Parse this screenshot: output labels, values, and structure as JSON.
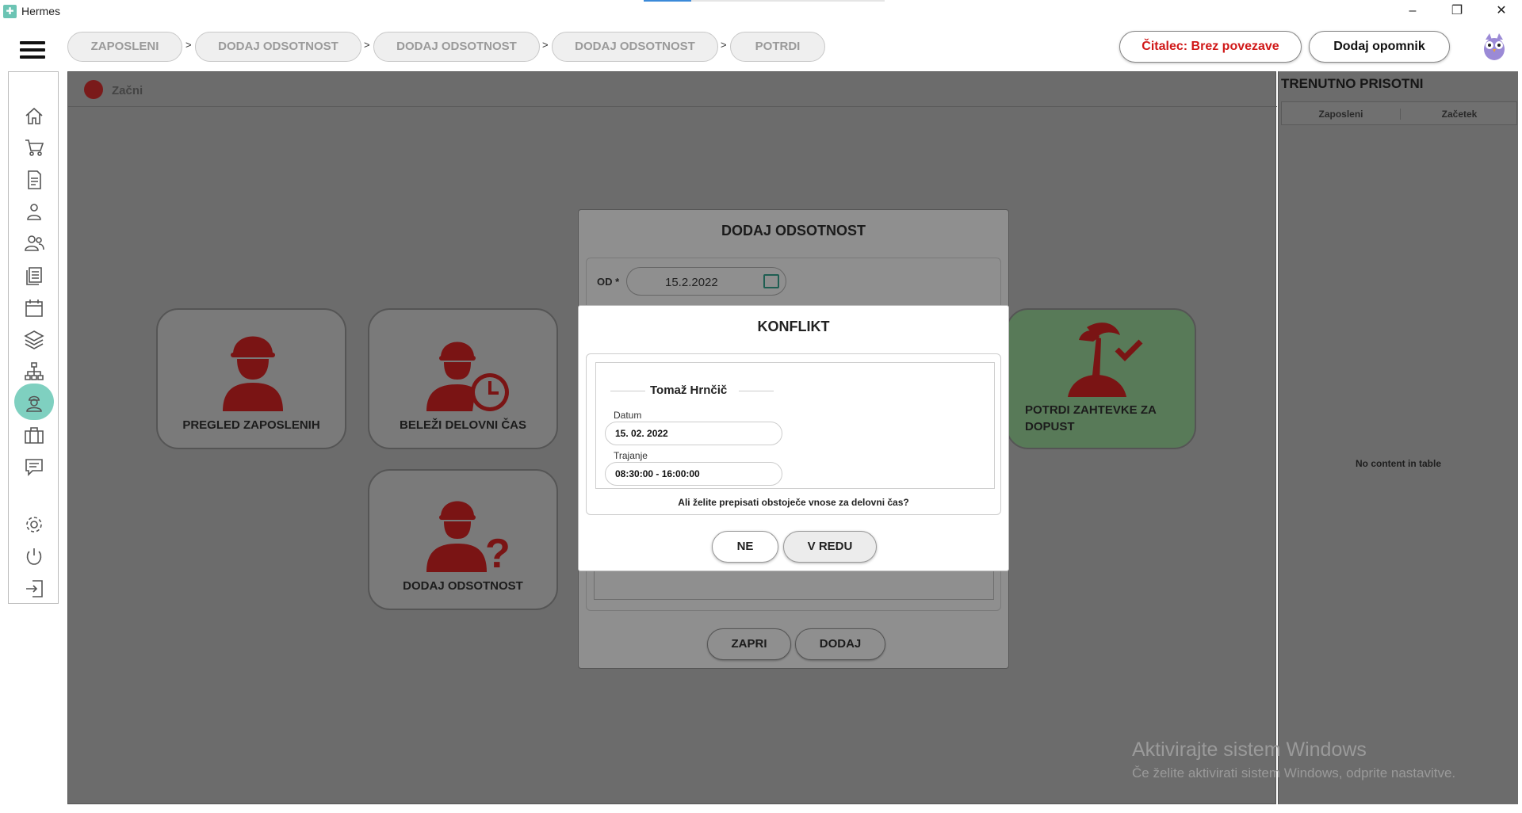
{
  "window": {
    "title": "Hermes",
    "icon": "app-logo-icon",
    "controls": [
      "minimize-icon",
      "restore-icon",
      "close-icon"
    ]
  },
  "breadcrumb": [
    {
      "label": "ZAPOSLENI"
    },
    {
      "label": "DODAJ ODSOTNOST"
    },
    {
      "label": "DODAJ ODSOTNOST"
    },
    {
      "label": "DODAJ ODSOTNOST"
    },
    {
      "label": "POTRDI"
    }
  ],
  "breadcrumb_separator": ">",
  "header": {
    "reader_status": "Čitalec: Brez povezave",
    "reader_status_color": "#d01818",
    "reminder_button": "Dodaj opomnik",
    "menu_icon": "hamburger-icon",
    "avatar_icon": "owl-mascot-icon"
  },
  "sidebar": {
    "items": [
      {
        "icon": "home-icon"
      },
      {
        "icon": "cart-icon"
      },
      {
        "icon": "document-icon"
      },
      {
        "icon": "person-icon"
      },
      {
        "icon": "people-icon"
      },
      {
        "icon": "list-icon"
      },
      {
        "icon": "calendar-icon"
      },
      {
        "icon": "layers-icon"
      },
      {
        "icon": "hierarchy-icon"
      },
      {
        "icon": "worker-icon",
        "active": true
      },
      {
        "icon": "briefcase-icon"
      },
      {
        "icon": "chat-icon"
      },
      {
        "icon": "gear-icon"
      },
      {
        "icon": "power-icon"
      },
      {
        "icon": "logout-icon"
      }
    ],
    "active_color": "#7fd0c0"
  },
  "main": {
    "start_label": "Začni",
    "tiles": [
      {
        "label": "PREGLED ZAPOSLENIH",
        "icon": "worker-icon"
      },
      {
        "label": "BELEŽI DELOVNI ČAS",
        "icon": "worker-clock-icon"
      },
      {
        "label": "DODAJ ODSOTNOST",
        "icon": "worker-question-icon"
      },
      {
        "label": "POTRDI ZAHTEVKE ZA DOPUST",
        "icon": "island-check-icon"
      }
    ],
    "tile_icon_color": "#7a1414",
    "approve_tile_color": "#587a58"
  },
  "presence": {
    "title": "TRENUTNO PRISOTNI",
    "columns": [
      "Zaposleni",
      "Začetek"
    ],
    "empty_text": "No content in table"
  },
  "absence_dialog": {
    "title": "DODAJ ODSOTNOST",
    "od_label": "OD *",
    "od_value": "15.2.2022",
    "close_button": "ZAPRI",
    "add_button": "DODAJ"
  },
  "conflict_dialog": {
    "title": "KONFLIKT",
    "employee": "Tomaž Hrnčič",
    "date_label": "Datum",
    "date_value": "15. 02. 2022",
    "duration_label": "Trajanje",
    "duration_value": "08:30:00 - 16:00:00",
    "question": "Ali želite prepisati obstoječe vnose za delovni čas?",
    "no_button": "NE",
    "ok_button": "V REDU"
  },
  "watermark": {
    "line1": "Aktivirajte sistem Windows",
    "line2": "Če želite aktivirati sistem Windows, odprite nastavitve."
  }
}
